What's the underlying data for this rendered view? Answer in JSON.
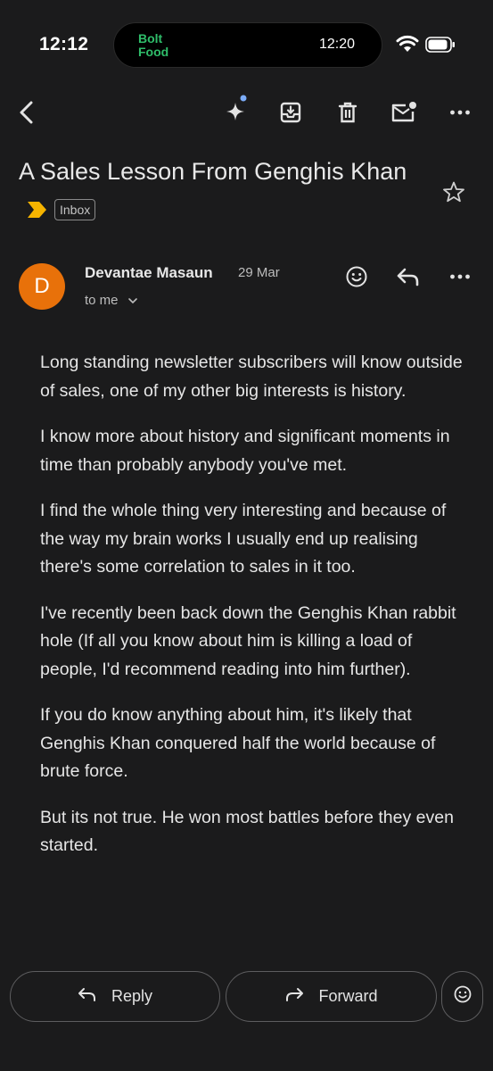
{
  "status_bar": {
    "time": "12:12",
    "island_logo_line1": "Bolt",
    "island_logo_line2": "Food",
    "island_time": "12:20"
  },
  "app_bar": {
    "icons": [
      "back-icon",
      "gemini-sparkle-icon",
      "archive-icon",
      "delete-icon",
      "mark-unread-icon",
      "more-icon"
    ]
  },
  "email": {
    "subject": "A Sales Lesson From Genghis Khan",
    "label": "Inbox",
    "sender_initial": "D",
    "sender_name": "Devantae Masaun",
    "date": "29 Mar",
    "recipient": "to me",
    "body": [
      "Long standing newsletter subscribers will know outside of sales, one of my other big interests is history.",
      "I know more about history and significant moments in time than probably anybody you've met.",
      "I find the whole thing very interesting and because of the way my brain works I usually end up realising there's some correlation to sales in it too.",
      "I've recently been back down the Genghis Khan rabbit hole (If all you know about him is killing a load of people, I'd recommend reading into him further).",
      "If you do know anything about him, it's likely that Genghis Khan conquered half the world because of brute force.",
      "But its not true. He won most battles before they even started."
    ]
  },
  "actions": {
    "reply_label": "Reply",
    "forward_label": "Forward"
  },
  "colors": {
    "background": "#1b1b1c",
    "avatar": "#e8710a",
    "important_marker": "#f6b400",
    "brand_green": "#2fbd6a",
    "badge_dot": "#7cacf8"
  }
}
